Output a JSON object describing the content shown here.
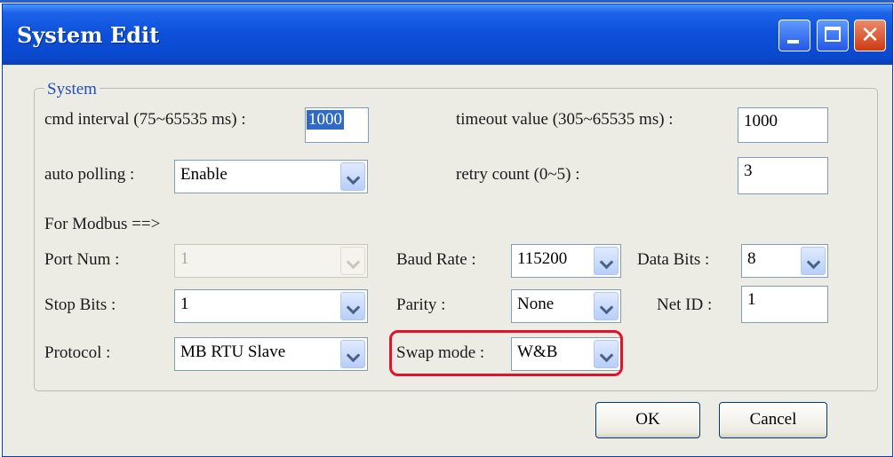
{
  "window": {
    "title": "System Edit"
  },
  "group": {
    "label": "System"
  },
  "fields": {
    "cmd_interval": {
      "label": "cmd interval (75~65535 ms) :",
      "value": "1000"
    },
    "timeout_value": {
      "label": "timeout value (305~65535 ms) :",
      "value": "1000"
    },
    "auto_polling": {
      "label": "auto polling :",
      "value": "Enable"
    },
    "retry_count": {
      "label": "retry count (0~5) :",
      "value": "3"
    },
    "modbus_header": "For Modbus ==>",
    "port_num": {
      "label": "Port Num :",
      "value": "1"
    },
    "baud_rate": {
      "label": "Baud Rate :",
      "value": "115200"
    },
    "data_bits": {
      "label": "Data Bits :",
      "value": "8"
    },
    "stop_bits": {
      "label": "Stop Bits :",
      "value": "1"
    },
    "parity": {
      "label": "Parity :",
      "value": "None"
    },
    "net_id": {
      "label": "Net ID :",
      "value": "1"
    },
    "protocol": {
      "label": "Protocol :",
      "value": "MB RTU Slave"
    },
    "swap_mode": {
      "label": "Swap mode :",
      "value": "W&B"
    }
  },
  "buttons": {
    "ok": "OK",
    "cancel": "Cancel"
  },
  "annotation": {
    "highlight_color": "#e2122b"
  }
}
